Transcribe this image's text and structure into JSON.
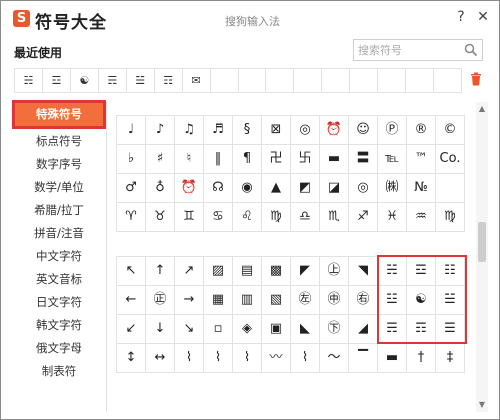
{
  "window": {
    "title": "符号大全",
    "subtitle": "搜狗输入法",
    "logo_text": "S",
    "close_glyph": "✕",
    "help_glyph": "?"
  },
  "recent": {
    "label": "最近使用",
    "items": [
      "☵",
      "☲",
      "☯",
      "☴",
      "☱",
      "☶",
      "✉",
      "",
      "",
      "",
      "",
      "",
      "",
      "",
      "",
      ""
    ]
  },
  "search": {
    "placeholder": "搜索符号"
  },
  "sidebar": {
    "items": [
      "特殊符号",
      "标点符号",
      "数字序号",
      "数学/单位",
      "希腊/拉丁",
      "拼音/注音",
      "中文字符",
      "英文音标",
      "日文字符",
      "韩文字符",
      "俄文字母",
      "制表符"
    ],
    "active_index": 0
  },
  "grid1": [
    "♩",
    "♪",
    "♫",
    "♬",
    "§",
    "⊠",
    "◎",
    "⏰",
    "☺",
    "Ⓟ",
    "®",
    "©",
    "♭",
    "♯",
    "♮",
    "‖",
    "¶",
    "卍",
    "卐",
    "▬",
    "〓",
    "℡",
    "™",
    "Co.",
    "♂",
    "♁",
    "⏰",
    "☊",
    "◉",
    "▲",
    "◩",
    "◪",
    "◎",
    "㈱",
    "№",
    "",
    "♈",
    "♉",
    "♊",
    "♋",
    "♌",
    "♍",
    "♎",
    "♏",
    "♐",
    "♓",
    "♒",
    "♍"
  ],
  "grid2": [
    "↖",
    "↑",
    "↗",
    "▨",
    "▤",
    "▩",
    "◤",
    "㊤",
    "◥",
    "☵",
    "☲",
    "☷",
    "←",
    "㊣",
    "→",
    "▦",
    "▥",
    "▧",
    "㊧",
    "㊥",
    "㊨",
    "☳",
    "☯",
    "☱",
    "↙",
    "↓",
    "↘",
    "▫",
    "◈",
    "▣",
    "◣",
    "㊦",
    "◢",
    "☴",
    "☶",
    "☰",
    "↕",
    "↔",
    "⌇",
    "⌇",
    "⌇",
    "〰",
    "⌇",
    "～",
    "▔",
    "▬",
    "†",
    "‡"
  ],
  "colors": {
    "accent": "#f26e3c",
    "highlight": "#e03535",
    "brand": "#e8582d"
  }
}
